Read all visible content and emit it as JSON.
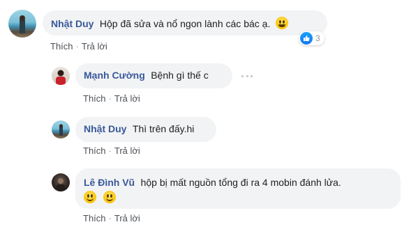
{
  "comments": [
    {
      "author": "Nhật Duy",
      "text": "Hộp đã sửa và nổ ngon lành các bác ạ.",
      "reaction_count": "3",
      "like_label": "Thích",
      "reply_label": "Trả lời"
    },
    {
      "author": "Mạnh Cường",
      "text": "Bệnh gì thế c",
      "like_label": "Thích",
      "reply_label": "Trả lời"
    },
    {
      "author": "Nhật Duy",
      "text": "Thì trên đấy.hi",
      "like_label": "Thích",
      "reply_label": "Trả lời"
    },
    {
      "author": "Lê Đình Vũ",
      "text": "hộp bị mất nguồn tổng đi ra 4 mobin đánh lửa.",
      "like_label": "Thích",
      "reply_label": "Trả lời"
    }
  ],
  "colors": {
    "name": "#385898",
    "bubble": "#f2f3f5",
    "like_blue": "#1877f2"
  },
  "icons": [
    "grinning-emoji-icon",
    "smile-emoji-icon",
    "more-options-icon",
    "like-thumb-icon"
  ]
}
